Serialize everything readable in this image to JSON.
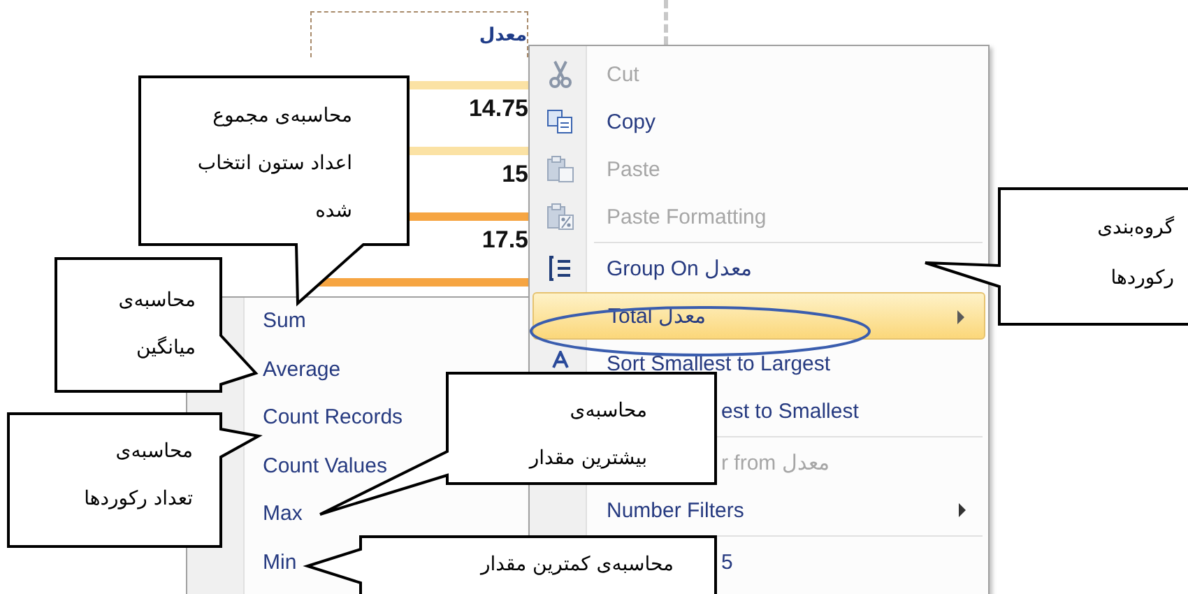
{
  "column": {
    "header": "معدل",
    "values": [
      "14.75",
      "15",
      "17.5"
    ]
  },
  "context_menu": {
    "items": [
      {
        "kind": "item",
        "label": "Cut",
        "disabled": true,
        "highlighted": false,
        "submenu": false
      },
      {
        "kind": "item",
        "label": "Copy",
        "disabled": false,
        "highlighted": false,
        "submenu": false
      },
      {
        "kind": "item",
        "label": "Paste",
        "disabled": true,
        "highlighted": false,
        "submenu": false
      },
      {
        "kind": "item",
        "label": "Paste Formatting",
        "disabled": true,
        "highlighted": false,
        "submenu": false
      },
      {
        "kind": "separator"
      },
      {
        "kind": "item",
        "label": "Group On معدل",
        "disabled": false,
        "highlighted": false,
        "submenu": false
      },
      {
        "kind": "item",
        "label": "Total معدل",
        "disabled": false,
        "highlighted": true,
        "submenu": true
      },
      {
        "kind": "item",
        "label": "Sort Smallest to Largest",
        "disabled": false,
        "highlighted": false,
        "submenu": false
      },
      {
        "kind": "covered",
        "label": "est to Smallest",
        "disabled": false,
        "highlighted": false,
        "submenu": false
      },
      {
        "kind": "separator"
      },
      {
        "kind": "covered",
        "label": "r from معدل",
        "disabled": true,
        "highlighted": false,
        "submenu": false
      },
      {
        "kind": "item",
        "label": "Number Filters",
        "disabled": false,
        "highlighted": false,
        "submenu": true
      },
      {
        "kind": "separator"
      },
      {
        "kind": "covered",
        "label": "5",
        "disabled": false,
        "highlighted": false,
        "submenu": false
      }
    ]
  },
  "total_submenu": {
    "items": [
      "Sum",
      "Average",
      "Count Records",
      "Count Values",
      "Max",
      "Min"
    ]
  },
  "callouts": [
    {
      "text": "محاسبه‌ی مجموع\nاعداد ستون انتخاب\nشده"
    },
    {
      "text": "محاسبه‌ی\nمیانگین"
    },
    {
      "text": "محاسبه‌ی\nتعداد رکوردها"
    },
    {
      "text": "محاسبه‌ی\nبیشترین مقدار"
    },
    {
      "text": "محاسبه‌ی کمترین مقدار"
    },
    {
      "text": "گروه‌بندی\nرکوردها"
    }
  ]
}
